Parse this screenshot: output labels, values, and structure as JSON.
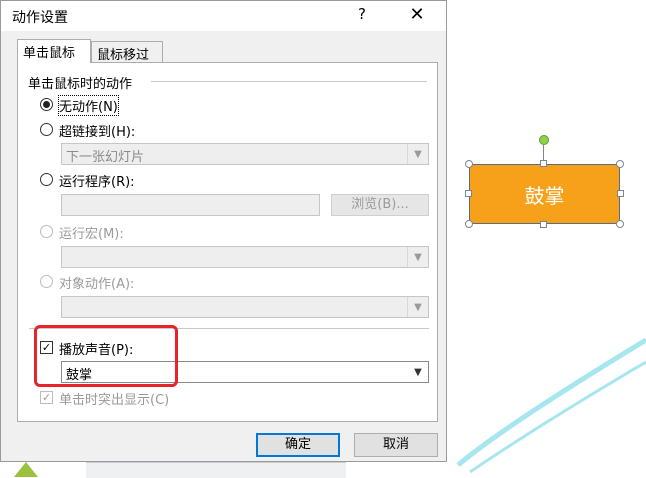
{
  "dialog": {
    "title": "动作设置",
    "help": "?",
    "close": "✕",
    "tabs": [
      {
        "label": "单击鼠标"
      },
      {
        "label": "鼠标移过"
      }
    ],
    "group_label": "单击鼠标时的动作",
    "options": {
      "none": {
        "label": "无动作(N)",
        "checked": true
      },
      "hyperlink": {
        "label": "超链接到(H):",
        "value": "下一张幻灯片"
      },
      "run_program": {
        "label": "运行程序(R):",
        "value": "",
        "browse_label": "浏览(B)..."
      },
      "run_macro": {
        "label": "运行宏(M):",
        "value": ""
      },
      "object_action": {
        "label": "对象动作(A):",
        "value": ""
      }
    },
    "play_sound": {
      "label": "播放声音(P):",
      "checked": true,
      "value": "鼓掌"
    },
    "highlight_click": {
      "label": "单击时突出显示(C)",
      "checked": true
    },
    "ok_label": "确定",
    "cancel_label": "取消"
  },
  "slide": {
    "shape_text": "鼓掌",
    "shape_fill": "#f7a11a"
  },
  "colors": {
    "accent": "#0078d7",
    "highlight_box": "#e8242a",
    "arc": "#a8e6ef"
  }
}
